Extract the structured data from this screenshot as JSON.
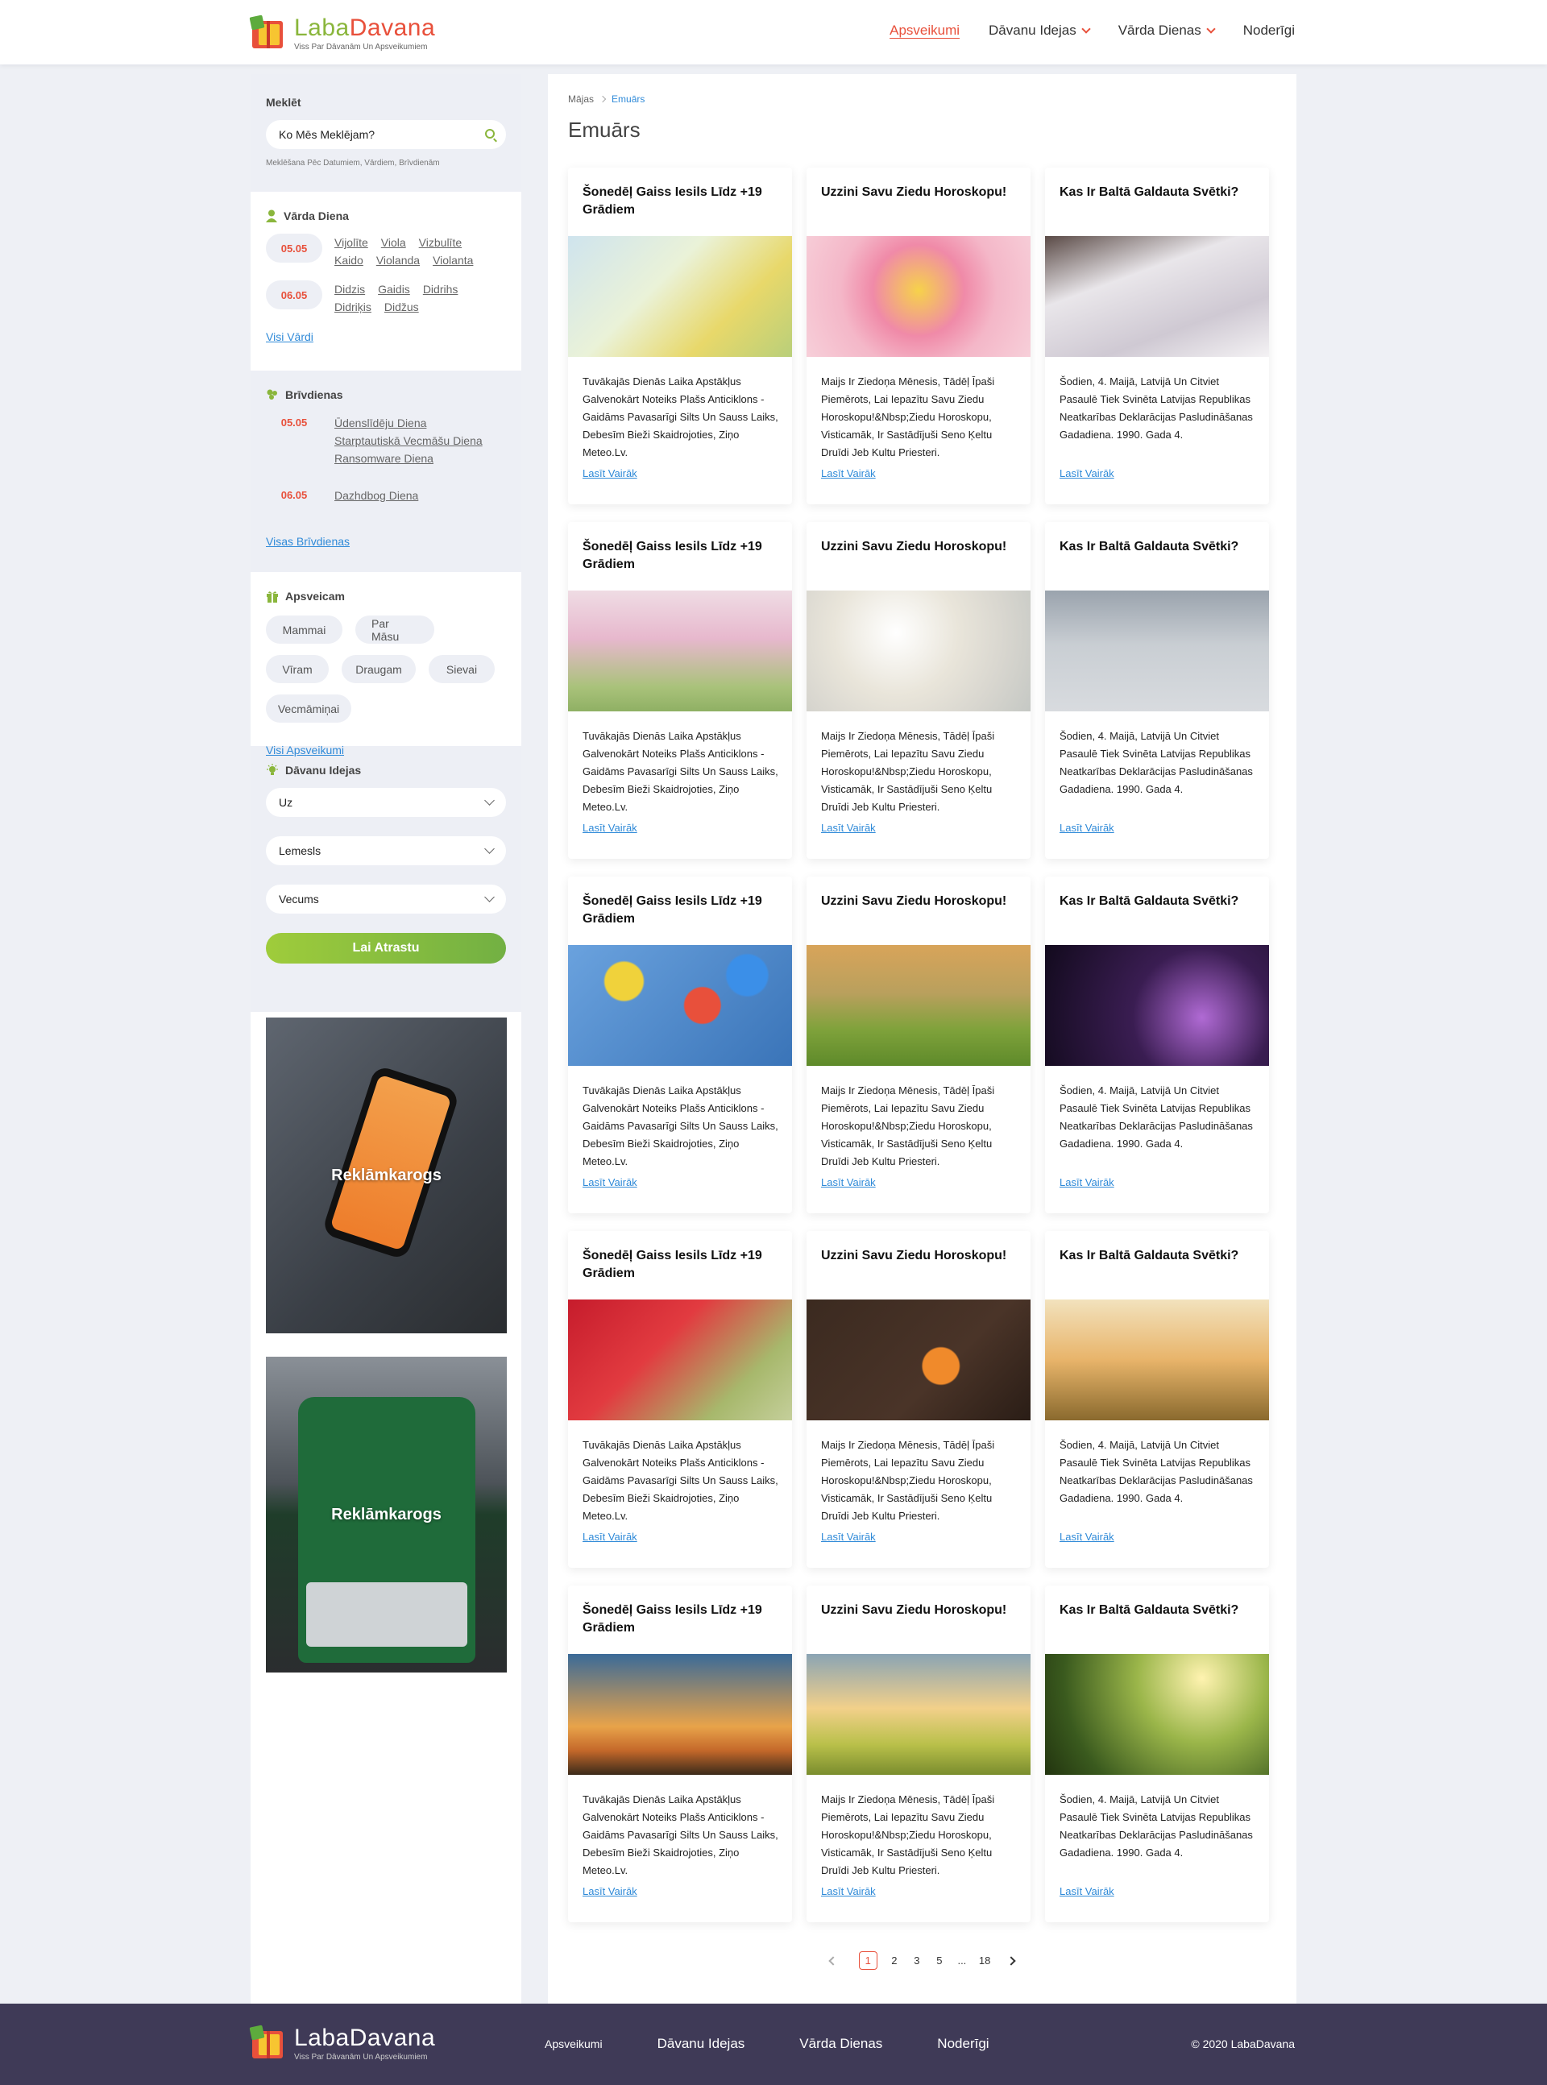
{
  "brand": {
    "name_part1": "Laba",
    "name_part2": "Davana",
    "footer_name": "LabaDavana",
    "tagline": "Viss Par Dāvanām Un Apsveikumiem"
  },
  "nav": [
    {
      "label": "Apsveikumi",
      "active": true,
      "dropdown": false
    },
    {
      "label": "Dāvanu Idejas",
      "active": false,
      "dropdown": true
    },
    {
      "label": "Vārda Dienas",
      "active": false,
      "dropdown": true
    },
    {
      "label": "Noderīgi",
      "active": false,
      "dropdown": false
    }
  ],
  "sidebar": {
    "search": {
      "title": "Meklēt",
      "placeholder": "Ko Mēs Meklējam?",
      "hint": "Meklēšana Pēc Datumiem, Vārdiem, Brīvdienām"
    },
    "names": {
      "title": "Vārda Diena",
      "rows": [
        {
          "date": "05.05",
          "names": [
            "Vijolīte",
            "Viola",
            "Vizbulīte",
            "Kaido",
            "Violanda",
            "Violanta"
          ]
        },
        {
          "date": "06.05",
          "names": [
            "Didzis",
            "Gaidis",
            "Didrihs",
            "Didriķis",
            "Didžus"
          ]
        }
      ],
      "link": "Visi Vārdi"
    },
    "holidays": {
      "title": "Brīvdienas",
      "rows": [
        {
          "date": "05.05",
          "items": [
            "Ūdenslīdēju Diena",
            "Starptautiskā Vecmāšu Diena",
            "Ransomware Diena"
          ]
        },
        {
          "date": "06.05",
          "items": [
            "Dazhdbog Diena"
          ]
        }
      ],
      "link": "Visas Brīvdienas"
    },
    "greet": {
      "title": "Apsveicam",
      "chips": [
        "Mammai",
        "Par Māsu",
        "Vīram",
        "Draugam",
        "Sievai",
        "Vecmāmiņai"
      ],
      "link": "Visi Apsveikumi"
    },
    "ideas": {
      "title": "Dāvanu Idejas",
      "selects": [
        "Uz",
        "Lemesls",
        "Vecums"
      ],
      "button": "Lai Atrastu"
    },
    "ads": [
      "Reklāmkarogs",
      "Reklāmkarogs"
    ]
  },
  "main": {
    "breadcrumb": {
      "home": "Mājas",
      "current": "Emuārs"
    },
    "title": "Emuārs",
    "cards": [
      {
        "title": "Šonedēļ Gaiss Iesils Līdz +19 Grādiem",
        "text": "Tuvākajās Dienās Laika Apstākļus Galvenokārt Noteiks Plašs Anticiklons - Gaidāms Pavasarīgi Silts Un Sauss Laiks, Debesīm Bieži Skaidrojoties, Ziņo Meteo.Lv.",
        "link": "Lasīt Vairāk",
        "img": "spring-branches"
      },
      {
        "title": "Uzzini Savu Ziedu Horoskopu!",
        "text": "Maijs Ir Ziedoņa Mēnesis, Tādēļ Īpaši Piemērots, Lai Iepazītu Savu Ziedu Horoskopu!&Nbsp;Ziedu Horoskopu, Visticamāk, Ir Sastādījuši Seno Ķeltu Druīdi Jeb Kultu Priesteri.",
        "link": "Lasīt Vairāk",
        "img": "flower-heart"
      },
      {
        "title": "Kas Ir Baltā Galdauta Svētki?",
        "text": "Šodien, 4. Maijā, Latvijā Un Citviet Pasaulē Tiek Svinēta Latvijas Republikas Neatkarības Deklarācijas Pasludināšanas Gadadiena. 1990. Gada 4.",
        "link": "Lasīt Vairāk",
        "img": "white-table"
      },
      {
        "title": "Šonedēļ Gaiss Iesils Līdz +19 Grādiem",
        "text": "Tuvākajās Dienās Laika Apstākļus Galvenokārt Noteiks Plašs Anticiklons - Gaidāms Pavasarīgi Silts Un Sauss Laiks, Debesīm Bieži Skaidrojoties, Ziņo Meteo.Lv.",
        "link": "Lasīt Vairāk",
        "img": "blossom-trees"
      },
      {
        "title": "Uzzini Savu Ziedu Horoskopu!",
        "text": "Maijs Ir Ziedoņa Mēnesis, Tādēļ Īpaši Piemērots, Lai Iepazītu Savu Ziedu Horoskopu!&Nbsp;Ziedu Horoskopu, Visticamāk, Ir Sastādījuši Seno Ķeltu Druīdi Jeb Kultu Priesteri.",
        "link": "Lasīt Vairāk",
        "img": "white-bouquet"
      },
      {
        "title": "Kas Ir Baltā Galdauta Svētki?",
        "text": "Šodien, 4. Maijā, Latvijā Un Citviet Pasaulē Tiek Svinēta Latvijas Republikas Neatkarības Deklarācijas Pasludināšanas Gadadiena. 1990. Gada 4.",
        "link": "Lasīt Vairāk",
        "img": "gift-box"
      },
      {
        "title": "Šonedēļ Gaiss Iesils Līdz +19 Grādiem",
        "text": "Tuvākajās Dienās Laika Apstākļus Galvenokārt Noteiks Plašs Anticiklons - Gaidāms Pavasarīgi Silts Un Sauss Laiks, Debesīm Bieži Skaidrojoties, Ziņo Meteo.Lv.",
        "link": "Lasīt Vairāk",
        "img": "balloons"
      },
      {
        "title": "Uzzini Savu Ziedu Horoskopu!",
        "text": "Maijs Ir Ziedoņa Mēnesis, Tādēļ Īpaši Piemērots, Lai Iepazītu Savu Ziedu Horoskopu!&Nbsp;Ziedu Horoskopu, Visticamāk, Ir Sastādījuši Seno Ķeltu Druīdi Jeb Kultu Priesteri.",
        "link": "Lasīt Vairāk",
        "img": "family-meadow"
      },
      {
        "title": "Kas Ir Baltā Galdauta Svētki?",
        "text": "Šodien, 4. Maijā, Latvijā Un Citviet Pasaulē Tiek Svinēta Latvijas Republikas Neatkarības Deklarācijas Pasludināšanas Gadadiena. 1990. Gada 4.",
        "link": "Lasīt Vairāk",
        "img": "confetti"
      },
      {
        "title": "Šonedēļ Gaiss Iesils Līdz +19 Grādiem",
        "text": "Tuvākajās Dienās Laika Apstākļus Galvenokārt Noteiks Plašs Anticiklons - Gaidāms Pavasarīgi Silts Un Sauss Laiks, Debesīm Bieži Skaidrojoties, Ziņo Meteo.Lv.",
        "link": "Lasīt Vairāk",
        "img": "red-leaves"
      },
      {
        "title": "Uzzini Savu Ziedu Horoskopu!",
        "text": "Maijs Ir Ziedoņa Mēnesis, Tādēļ Īpaši Piemērots, Lai Iepazītu Savu Ziedu Horoskopu!&Nbsp;Ziedu Horoskopu, Visticamāk, Ir Sastādījuši Seno Ķeltu Druīdi Jeb Kultu Priesteri.",
        "link": "Lasīt Vairāk",
        "img": "tangerines"
      },
      {
        "title": "Kas Ir Baltā Galdauta Svētki?",
        "text": "Šodien, 4. Maijā, Latvijā Un Citviet Pasaulē Tiek Svinēta Latvijas Republikas Neatkarības Deklarācijas Pasludināšanas Gadadiena. 1990. Gada 4.",
        "link": "Lasīt Vairāk",
        "img": "jumping-friends"
      },
      {
        "title": "Šonedēļ Gaiss Iesils Līdz +19 Grādiem",
        "text": "Tuvākajās Dienās Laika Apstākļus Galvenokārt Noteiks Plašs Anticiklons - Gaidāms Pavasarīgi Silts Un Sauss Laiks, Debesīm Bieži Skaidrojoties, Ziņo Meteo.Lv.",
        "link": "Lasīt Vairāk",
        "img": "hot-air-balloon"
      },
      {
        "title": "Uzzini Savu Ziedu Horoskopu!",
        "text": "Maijs Ir Ziedoņa Mēnesis, Tādēļ Īpaši Piemērots, Lai Iepazītu Savu Ziedu Horoskopu!&Nbsp;Ziedu Horoskopu, Visticamāk, Ir Sastādījuši Seno Ķeltu Druīdi Jeb Kultu Priesteri.",
        "link": "Lasīt Vairāk",
        "img": "butterflies-sunrise"
      },
      {
        "title": "Kas Ir Baltā Galdauta Svētki?",
        "text": "Šodien, 4. Maijā, Latvijā Un Citviet Pasaulē Tiek Svinēta Latvijas Republikas Neatkarības Deklarācijas Pasludināšanas Gadadiena. 1990. Gada 4.",
        "link": "Lasīt Vairāk",
        "img": "girl-forest"
      }
    ],
    "pagination": {
      "pages": [
        "1",
        "2",
        "3",
        "5",
        "...",
        "18"
      ],
      "current": "1"
    }
  },
  "footer": {
    "nav": [
      "Apsveikumi",
      "Dāvanu Idejas",
      "Vārda Dienas",
      "Noderīgi"
    ],
    "copyright": "© 2020 LabaDavana"
  },
  "colors": {
    "accent": "#e8503b",
    "green": "#8ab63c",
    "link": "#2f8ad8",
    "footer": "#3f3a57"
  }
}
